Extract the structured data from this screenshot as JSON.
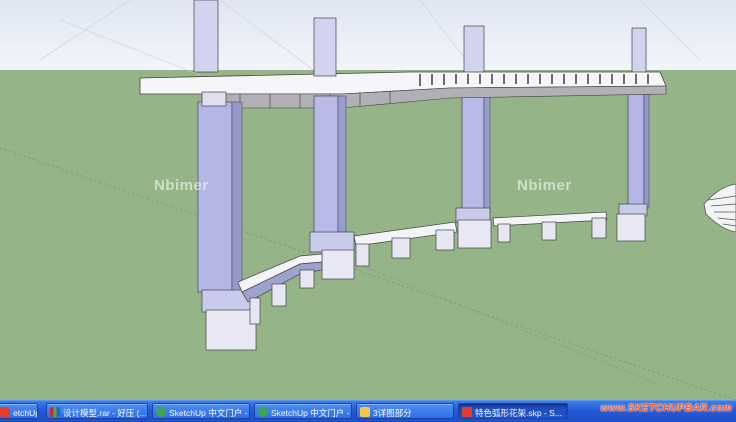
{
  "viewport": {
    "sky_color": "#e6ecf5",
    "ground_color": "#95b588",
    "model_face_color": "#e4e4ee",
    "column_color": "#b4b6e6",
    "watermarks": [
      "Nbimer",
      "Nbimer"
    ]
  },
  "taskbar": {
    "items": [
      {
        "label": "etchUp ...",
        "icon": "sketchup-icon"
      },
      {
        "label": "设计模型.rar - 好压 (...",
        "icon": "archive-icon"
      },
      {
        "label": "SketchUp 中文门户 - ...",
        "icon": "browser-icon"
      },
      {
        "label": "SketchUp 中文门户 - ...",
        "icon": "browser-icon"
      },
      {
        "label": "3详图部分",
        "icon": "folder-icon"
      },
      {
        "label": "特色弧形花架.skp - S...",
        "icon": "sketchup-icon"
      }
    ],
    "active_index": 5,
    "brand": "www.SKETCHUPBAR.com"
  }
}
